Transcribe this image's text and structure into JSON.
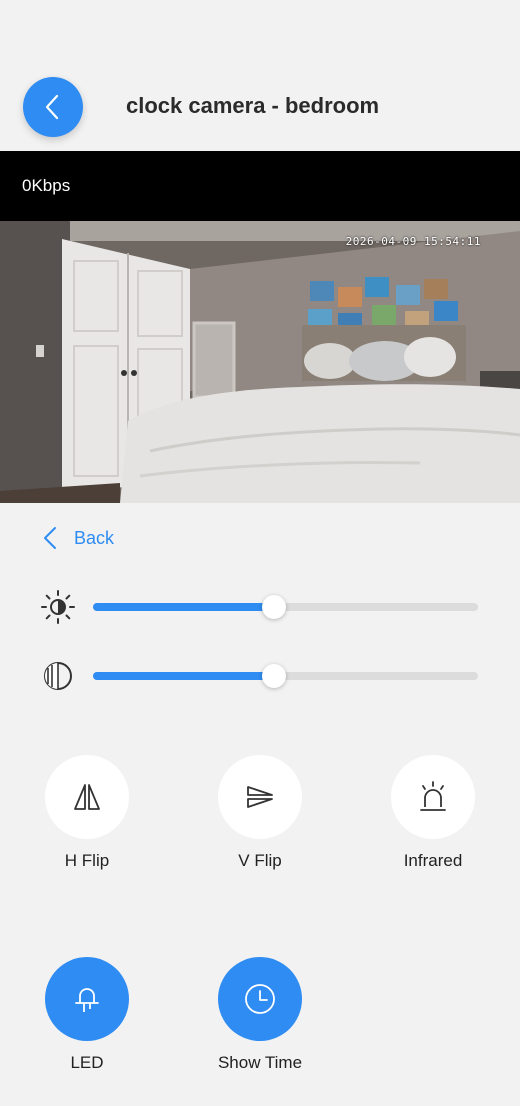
{
  "header": {
    "title": "clock camera - bedroom",
    "back_icon": "chevron-left-icon"
  },
  "stream": {
    "bitrate": "0Kbps",
    "timestamp": "2026-04-09 15:54:11"
  },
  "panel": {
    "back_label": "Back",
    "brightness": {
      "icon": "brightness-icon",
      "level": 0.47
    },
    "contrast": {
      "icon": "contrast-icon",
      "level": 0.47
    }
  },
  "controls": [
    {
      "label": "H Flip",
      "icon": "h-flip-icon",
      "active": false
    },
    {
      "label": "V Flip",
      "icon": "v-flip-icon",
      "active": false
    },
    {
      "label": "Infrared",
      "icon": "infrared-alarm-icon",
      "active": false
    },
    {
      "label": "LED",
      "icon": "led-bulb-icon",
      "active": true
    },
    {
      "label": "Show Time",
      "icon": "clock-icon",
      "active": true
    }
  ],
  "colors": {
    "accent": "#2f8cf2",
    "background": "#f2f2f2",
    "bar": "#000000"
  }
}
